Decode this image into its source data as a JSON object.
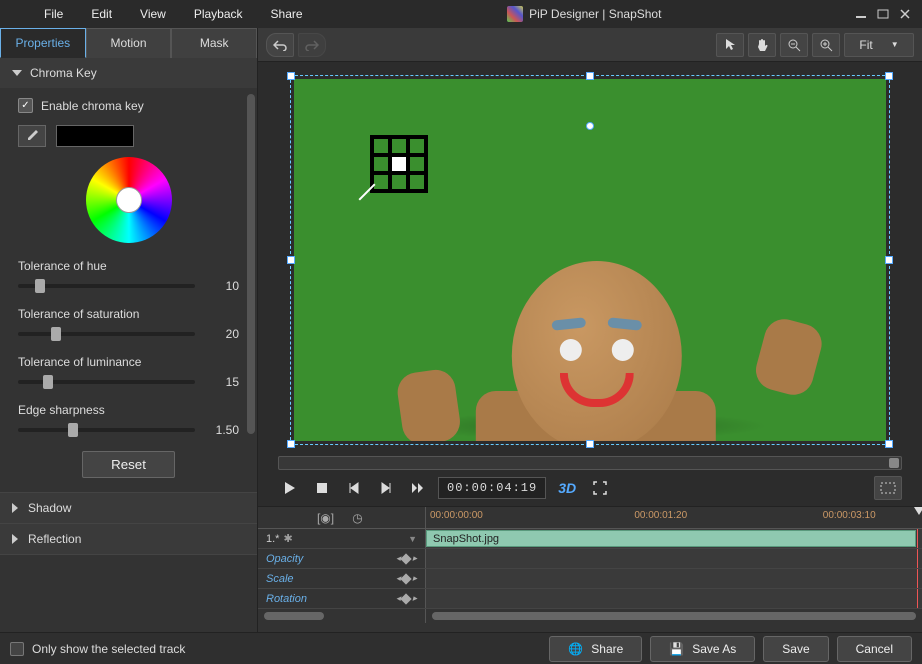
{
  "title": "PiP Designer | SnapShot",
  "menu": [
    "File",
    "Edit",
    "View",
    "Playback",
    "Share"
  ],
  "tabs": {
    "properties": "Properties",
    "motion": "Motion",
    "mask": "Mask"
  },
  "chroma": {
    "title": "Chroma Key",
    "enable": "Enable chroma key",
    "hue_label": "Tolerance of hue",
    "hue_val": "10",
    "sat_label": "Tolerance of saturation",
    "sat_val": "20",
    "lum_label": "Tolerance of luminance",
    "lum_val": "15",
    "edge_label": "Edge sharpness",
    "edge_val": "1.50",
    "reset": "Reset"
  },
  "sections": {
    "shadow": "Shadow",
    "reflection": "Reflection"
  },
  "zoom": "Fit",
  "timecode": "00:00:04:19",
  "btn3d": "3D",
  "timeline": {
    "marks": [
      "00:00:00:00",
      "00:00:01:20",
      "00:00:03:10"
    ],
    "track_name": "1.*",
    "clip": "SnapShot.jpg",
    "props": [
      "Opacity",
      "Scale",
      "Rotation"
    ]
  },
  "footer": {
    "only_track": "Only show the selected track",
    "share": "Share",
    "saveas": "Save As",
    "save": "Save",
    "cancel": "Cancel"
  }
}
